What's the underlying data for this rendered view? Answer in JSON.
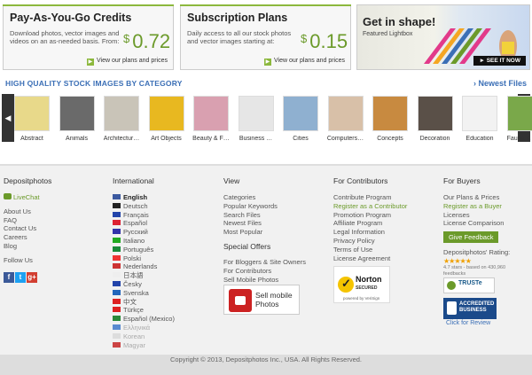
{
  "plans": [
    {
      "title": "Pay-As-You-Go Credits",
      "desc": "Download photos, vector images and videos on an as-needed basis. From:",
      "currency": "$",
      "price": "0.72",
      "link": "View our plans and prices"
    },
    {
      "title": "Subscription Plans",
      "desc": "Daily access to all our stock photos and vector images starting at:",
      "currency": "$",
      "price": "0.15",
      "link": "View our plans and prices"
    }
  ],
  "promo": {
    "title": "Get in shape!",
    "subtitle": "Featured Lightbox",
    "button": "► SEE IT NOW"
  },
  "categories_header": "HIGH QUALITY STOCK IMAGES BY CATEGORY",
  "newest_link": "Newest Files",
  "categories": [
    {
      "label": "Abstract",
      "color": "#e8d98a"
    },
    {
      "label": "Animals",
      "color": "#6a6a6a"
    },
    {
      "label": "Architectur…",
      "color": "#c9c4b8"
    },
    {
      "label": "Art Objects",
      "color": "#e8b820"
    },
    {
      "label": "Beauty & F…",
      "color": "#d9a0b0"
    },
    {
      "label": "Business …",
      "color": "#e6e6e6"
    },
    {
      "label": "Cities",
      "color": "#8fb0d0"
    },
    {
      "label": "Computers…",
      "color": "#d8c0a8"
    },
    {
      "label": "Concepts",
      "color": "#c88a40"
    },
    {
      "label": "Decoration",
      "color": "#5a5048"
    },
    {
      "label": "Education",
      "color": "#f2f2f2"
    },
    {
      "label": "Fauna & F…",
      "color": "#7aa84a"
    }
  ],
  "footer": {
    "depositphotos": {
      "title": "Depositphotos",
      "livechat": "LiveChat",
      "links": [
        "About Us",
        "FAQ",
        "Contact Us",
        "Careers",
        "Blog"
      ],
      "follow": "Follow Us"
    },
    "international": {
      "title": "International",
      "languages": [
        {
          "name": "English",
          "style": "bold",
          "flag": "#3c5aa0"
        },
        {
          "name": "Deutsch",
          "style": "",
          "flag": "#222"
        },
        {
          "name": "Français",
          "style": "",
          "flag": "#2244aa"
        },
        {
          "name": "Español",
          "style": "",
          "flag": "#d23"
        },
        {
          "name": "Русский",
          "style": "",
          "flag": "#33a"
        },
        {
          "name": "Italiano",
          "style": "",
          "flag": "#2a2"
        },
        {
          "name": "Português",
          "style": "",
          "flag": "#1a8a3a"
        },
        {
          "name": "Polski",
          "style": "",
          "flag": "#e33"
        },
        {
          "name": "Nederlands",
          "style": "",
          "flag": "#c33"
        },
        {
          "name": "日本語",
          "style": "",
          "flag": "#eee"
        },
        {
          "name": "Česky",
          "style": "",
          "flag": "#2244aa"
        },
        {
          "name": "Svenska",
          "style": "",
          "flag": "#2266bb"
        },
        {
          "name": "中文",
          "style": "",
          "flag": "#d22"
        },
        {
          "name": "Türkçe",
          "style": "",
          "flag": "#d22"
        },
        {
          "name": "Español (Mexico)",
          "style": "",
          "flag": "#2a8a3a"
        },
        {
          "name": "Ελληνικά",
          "style": "dim",
          "flag": "#5a8ad0"
        },
        {
          "name": "Korean",
          "style": "dim",
          "flag": "#ddd"
        },
        {
          "name": "Magyar",
          "style": "dim",
          "flag": "#c44"
        }
      ]
    },
    "view": {
      "title": "View",
      "links": [
        "Categories",
        "Popular Keywords",
        "Search Files",
        "Newest Files",
        "Most Popular"
      ],
      "special_title": "Special Offers",
      "special": [
        "For Bloggers & Site Owners",
        "For Contributors",
        "Sell Mobile Photos"
      ],
      "mobile_line1": "Sell mobile",
      "mobile_line2": "Photos"
    },
    "contributors": {
      "title": "For Contributors",
      "links": [
        {
          "t": "Contribute Program",
          "s": ""
        },
        {
          "t": "Register as a Contributor",
          "s": "green"
        },
        {
          "t": "Promotion Program",
          "s": ""
        },
        {
          "t": "Affiliate Program",
          "s": ""
        },
        {
          "t": "Legal Information",
          "s": ""
        },
        {
          "t": "Privacy Policy",
          "s": ""
        },
        {
          "t": "Terms of Use",
          "s": ""
        },
        {
          "t": "License Agreement",
          "s": ""
        }
      ],
      "norton_title": "Norton",
      "norton_sub": "SECURED",
      "norton_by": "powered by VeriSign"
    },
    "buyers": {
      "title": "For Buyers",
      "links": [
        {
          "t": "Our Plans & Prices",
          "s": ""
        },
        {
          "t": "Register as a Buyer",
          "s": "green"
        },
        {
          "t": "Licenses",
          "s": ""
        },
        {
          "t": "License Comparison",
          "s": ""
        }
      ],
      "feedback": "Give Feedback",
      "rating_label": "Depositphotos' Rating:",
      "stars": "★★★★★",
      "rating_text": "4.7 stars - based on 430,960 feedbacks",
      "truste": "TRUSTe",
      "bbb": "ACCREDITED BUSINESS",
      "bbb_review": "Click for Review"
    }
  },
  "copyright": "Copyright © 2013, Depositphotos Inc., USA. All Rights Reserved."
}
